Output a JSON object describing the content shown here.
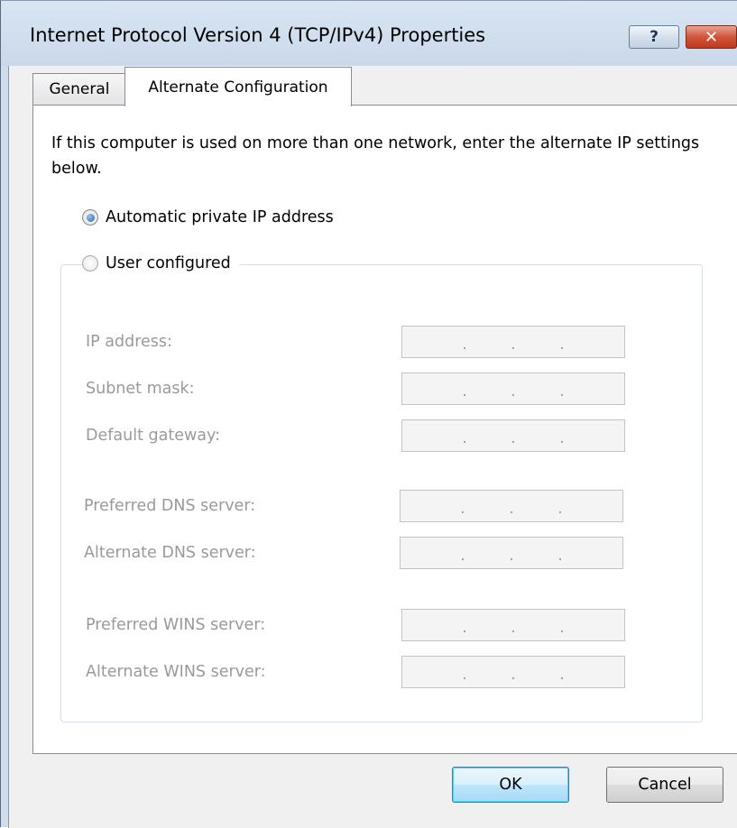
{
  "window": {
    "title": "Internet Protocol Version 4 (TCP/IPv4) Properties",
    "help_glyph": "?",
    "close_glyph": "✕"
  },
  "tabs": [
    {
      "label": "General",
      "selected": false
    },
    {
      "label": "Alternate Configuration",
      "selected": true
    }
  ],
  "description": "If this computer is used on more than one network, enter the alternate IP settings below.",
  "options": {
    "automatic": {
      "label": "Automatic private IP address",
      "checked": true
    },
    "user": {
      "label": "User configured",
      "checked": false
    }
  },
  "fields": {
    "ip_address": {
      "label": "IP address:",
      "value": ""
    },
    "subnet_mask": {
      "label": "Subnet mask:",
      "value": ""
    },
    "default_gateway": {
      "label": "Default gateway:",
      "value": ""
    },
    "preferred_dns": {
      "label": "Preferred DNS server:",
      "value": ""
    },
    "alternate_dns": {
      "label": "Alternate DNS server:",
      "value": ""
    },
    "preferred_wins": {
      "label": "Preferred WINS server:",
      "value": ""
    },
    "alternate_wins": {
      "label": "Alternate WINS server:",
      "value": ""
    }
  },
  "buttons": {
    "ok": "OK",
    "cancel": "Cancel"
  },
  "colors": {
    "titlebar": "#c9d8ea",
    "close_button": "#c0391e",
    "disabled_text": "#9a9a9a",
    "radio_selected": "#2a68b3",
    "ok_button_focus": "#3c7fb1"
  }
}
